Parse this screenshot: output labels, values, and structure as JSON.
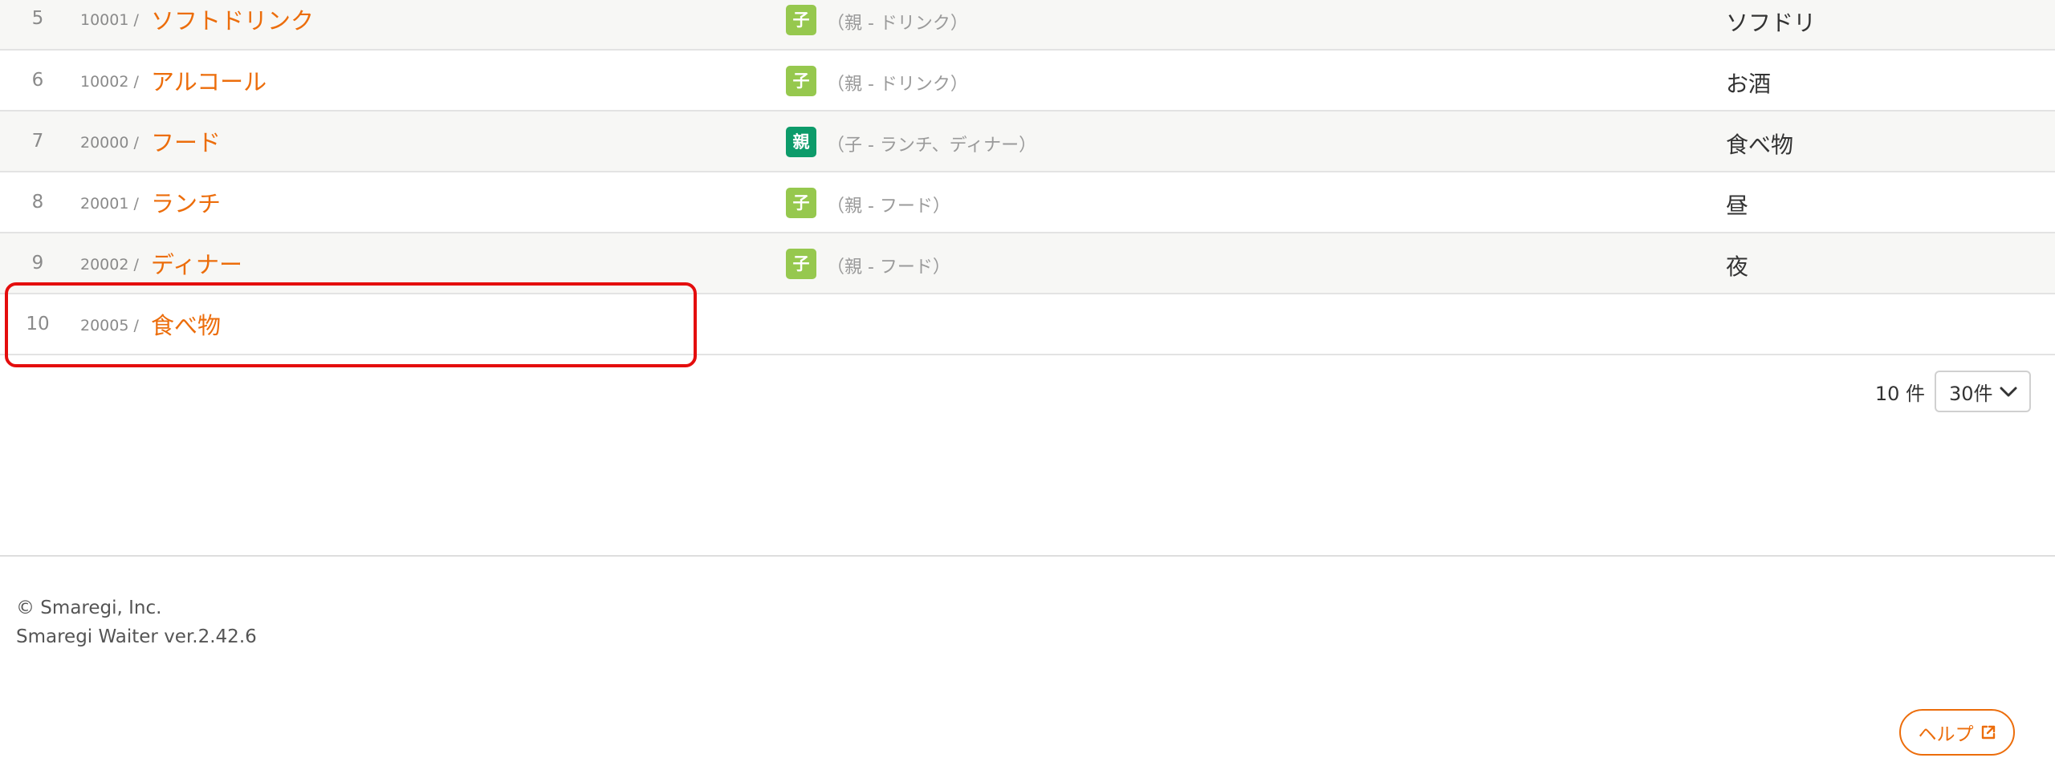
{
  "rows": [
    {
      "num": "5",
      "code": "10001 /",
      "name": "ソフトドリンク",
      "badge": "子",
      "badge_type": "child",
      "relation": "（親 - ドリンク）",
      "display": "ソフドリ"
    },
    {
      "num": "6",
      "code": "10002 /",
      "name": "アルコール",
      "badge": "子",
      "badge_type": "child",
      "relation": "（親 - ドリンク）",
      "display": "お酒"
    },
    {
      "num": "7",
      "code": "20000 /",
      "name": "フード",
      "badge": "親",
      "badge_type": "parent",
      "relation": "（子 - ランチ、ディナー）",
      "display": "食べ物"
    },
    {
      "num": "8",
      "code": "20001 /",
      "name": "ランチ",
      "badge": "子",
      "badge_type": "child",
      "relation": "（親 - フード）",
      "display": "昼"
    },
    {
      "num": "9",
      "code": "20002 /",
      "name": "ディナー",
      "badge": "子",
      "badge_type": "child",
      "relation": "（親 - フード）",
      "display": "夜"
    },
    {
      "num": "10",
      "code": "20005 /",
      "name": "食べ物",
      "badge": "",
      "badge_type": "",
      "relation": "",
      "display": ""
    }
  ],
  "pager": {
    "count": "10 件",
    "per_page": "30件"
  },
  "footer": {
    "copyright": "© Smaregi, Inc.",
    "version": "Smaregi Waiter ver.2.42.6"
  },
  "help": {
    "label": "ヘルプ"
  },
  "colors": {
    "accent": "#ec6d0b",
    "child_badge": "#96c84e",
    "parent_badge": "#0d9b6a",
    "highlight": "#e40d0d"
  }
}
